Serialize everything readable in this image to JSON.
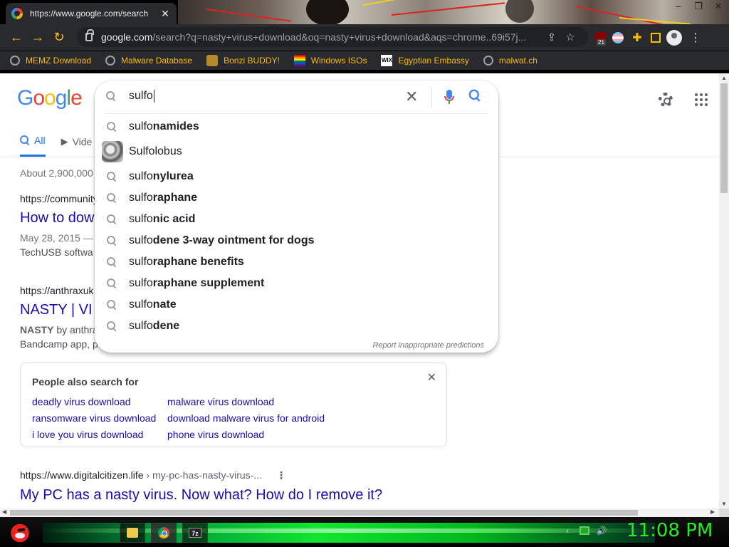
{
  "browser": {
    "tab_title": "https://www.google.com/search",
    "tab_close": "✕",
    "url_host": "google.com",
    "url_path": "/search?q=nasty+virus+download&oq=nasty+virus+download&aqs=chrome..69i57j...",
    "ublock_badge": "21",
    "bookmarks": [
      {
        "label": "MEMZ Download",
        "icon": "globe-icon"
      },
      {
        "label": "Malware Database",
        "icon": "globe-icon"
      },
      {
        "label": "Bonzi BUDDY!",
        "icon": "bonzi-icon"
      },
      {
        "label": "Windows ISOs",
        "icon": "rainbow-flag-icon"
      },
      {
        "label": "Egyptian Embassy",
        "icon": "wix-icon"
      },
      {
        "label": "malwat.ch",
        "icon": "globe-icon"
      }
    ]
  },
  "google": {
    "logo": [
      "G",
      "o",
      "o",
      "g",
      "l",
      "e"
    ],
    "logo_colors": [
      "#4285f4",
      "#ea4335",
      "#fbbc05",
      "#4285f4",
      "#34a853",
      "#ea4335"
    ],
    "search_query": "sulfo",
    "suggestions": [
      {
        "prefix": "sulfo",
        "rest": "namides"
      },
      {
        "label": "Sulfolobus",
        "thumb": true
      },
      {
        "prefix": "sulfo",
        "rest": "nylurea"
      },
      {
        "prefix": "sulfo",
        "rest": "raphane"
      },
      {
        "prefix": "sulfo",
        "rest": "nic acid"
      },
      {
        "prefix": "sulfo",
        "rest": "dene 3-way ointment for dogs"
      },
      {
        "prefix": "sulfo",
        "rest": "raphane benefits"
      },
      {
        "prefix": "sulfo",
        "rest": "raphane supplement"
      },
      {
        "prefix": "sulfo",
        "rest": "nate"
      },
      {
        "prefix": "sulfo",
        "rest": "dene"
      }
    ],
    "report_text": "Report inappropriate predictions",
    "tabs": {
      "all": "All",
      "videos": "Vide"
    },
    "result_stats": "About 2,900,000",
    "results": [
      {
        "cite": "https://community",
        "title": "How to dow",
        "date": "May 28, 2015 —",
        "snippet": "TechUSB softwa"
      },
      {
        "cite": "https://anthraxuk",
        "title": "NASTY | VI",
        "snippet_bold": "NASTY",
        "snippet": " by anthra",
        "snippet2": "Bandcamp app, p"
      },
      {
        "cite": "https://www.digitalcitizen.life",
        "crumb": " › my-pc-has-nasty-virus-...",
        "title": "My PC has a nasty virus. Now what? How do I remove it?"
      }
    ],
    "people_also_search": {
      "title": "People also search for",
      "close": "✕",
      "links": [
        "deadly virus download",
        "malware virus download",
        "ransomware virus download",
        "download malware virus for android",
        "i love you virus download",
        "phone virus download"
      ]
    }
  },
  "taskbar": {
    "clock": "11:08 PM",
    "apps": [
      "file-explorer-icon",
      "chrome-icon",
      "7zip-icon"
    ],
    "seven_zip_label": "7z"
  }
}
